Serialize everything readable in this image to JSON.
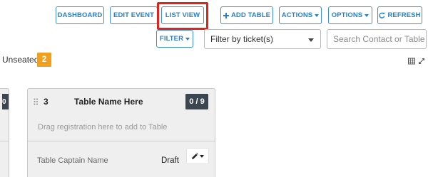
{
  "toolbar": {
    "dashboard": "DASHBOARD",
    "edit_event": "EDIT EVENT",
    "list_view": "LIST VIEW",
    "add_table": "ADD TABLE",
    "actions": "ACTIONS",
    "options": "OPTIONS",
    "refresh": "REFRESH"
  },
  "filters": {
    "filter_label": "FILTER",
    "ticket_select_value": "Filter by ticket(s)",
    "search_placeholder": "Search Contact or Table"
  },
  "unseated": {
    "label": "Unseated",
    "count": "2"
  },
  "left_card": {
    "count_partial": "0"
  },
  "table_card": {
    "number": "3",
    "name": "Table Name Here",
    "count": "0 / 9",
    "drop_hint": "Drag registration here to add to Table",
    "captain": "Table Captain Name",
    "status": "Draft"
  },
  "colors": {
    "accent": "#2a7fc8",
    "highlight": "#e0241b",
    "badge_orange": "#f0a020",
    "badge_dark": "#3c4650"
  },
  "icons": {
    "add": "plus-icon",
    "refresh": "refresh-icon",
    "grid": "grid-icon",
    "expand": "expand-icon",
    "edit": "pencil-icon",
    "drag": "drag-handle-icon"
  }
}
